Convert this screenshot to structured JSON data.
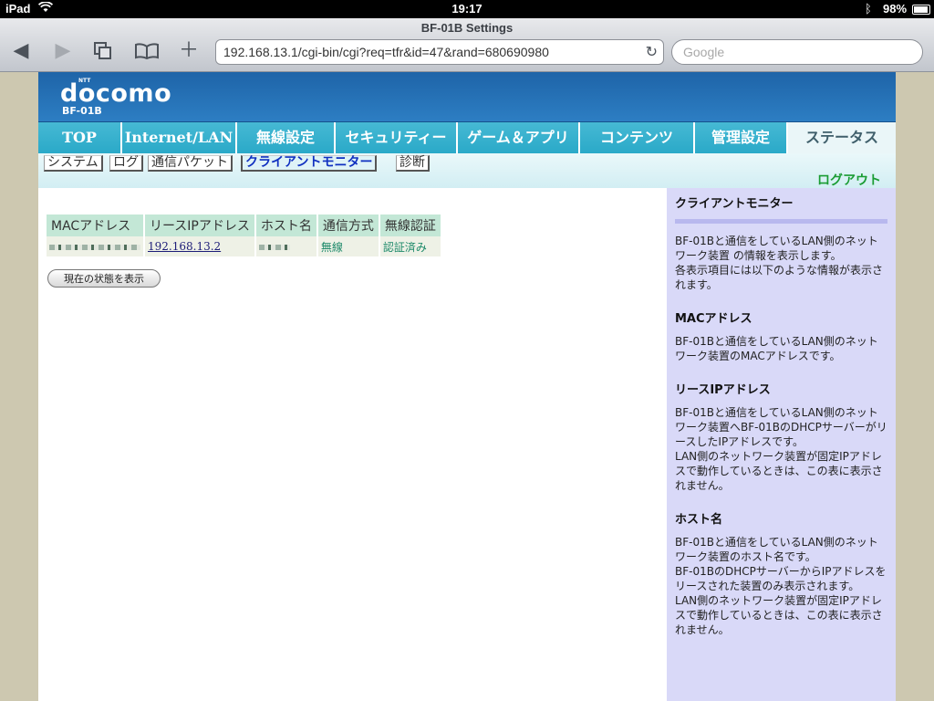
{
  "status_bar": {
    "device": "iPad",
    "time": "19:17",
    "battery": "98%"
  },
  "browser": {
    "title": "BF-01B Settings",
    "url": "192.168.13.1/cgi-bin/cgi?req=tfr&id=47&rand=680690980",
    "search_placeholder": "Google"
  },
  "header": {
    "brand_small": "NTT",
    "brand": "docomo",
    "model": "BF-01B"
  },
  "tabs": [
    "TOP",
    "Internet/LAN",
    "無線設定",
    "セキュリティー",
    "ゲーム＆アプリ",
    "コンテンツ",
    "管理設定",
    "ステータス"
  ],
  "subnav": [
    "システム",
    "ログ",
    "通信パケット",
    "クライアントモニター",
    "診断"
  ],
  "logout_label": "ログアウト",
  "table": {
    "headers": [
      "MACアドレス",
      "リースIPアドレス",
      "ホスト名",
      "通信方式",
      "無線認証"
    ],
    "rows": [
      {
        "ip": "192.168.13.2",
        "method": "無線",
        "auth": "認証済み"
      }
    ]
  },
  "refresh_button": "現在の状態を表示",
  "help": {
    "title": "クライアントモニター",
    "intro": [
      "BF-01Bと通信をしているLAN側のネットワーク装置 の情報を表示します。",
      "各表示項目には以下のような情報が表示されます。"
    ],
    "sections": [
      {
        "heading": "MACアドレス",
        "lines": [
          "BF-01Bと通信をしているLAN側のネットワーク装置のMACアドレスです。"
        ]
      },
      {
        "heading": "リースIPアドレス",
        "lines": [
          "BF-01Bと通信をしているLAN側のネットワーク装置へBF-01BのDHCPサーバーがリースしたIPアドレスです。",
          "LAN側のネットワーク装置が固定IPアドレスで動作しているときは、この表に表示されません。"
        ]
      },
      {
        "heading": "ホスト名",
        "lines": [
          "BF-01Bと通信をしているLAN側のネットワーク装置のホスト名です。",
          "BF-01BのDHCPサーバーからIPアドレスをリースされた装置のみ表示されます。",
          "LAN側のネットワーク装置が固定IPアドレスで動作しているときは、この表に表示されません。"
        ]
      }
    ]
  }
}
